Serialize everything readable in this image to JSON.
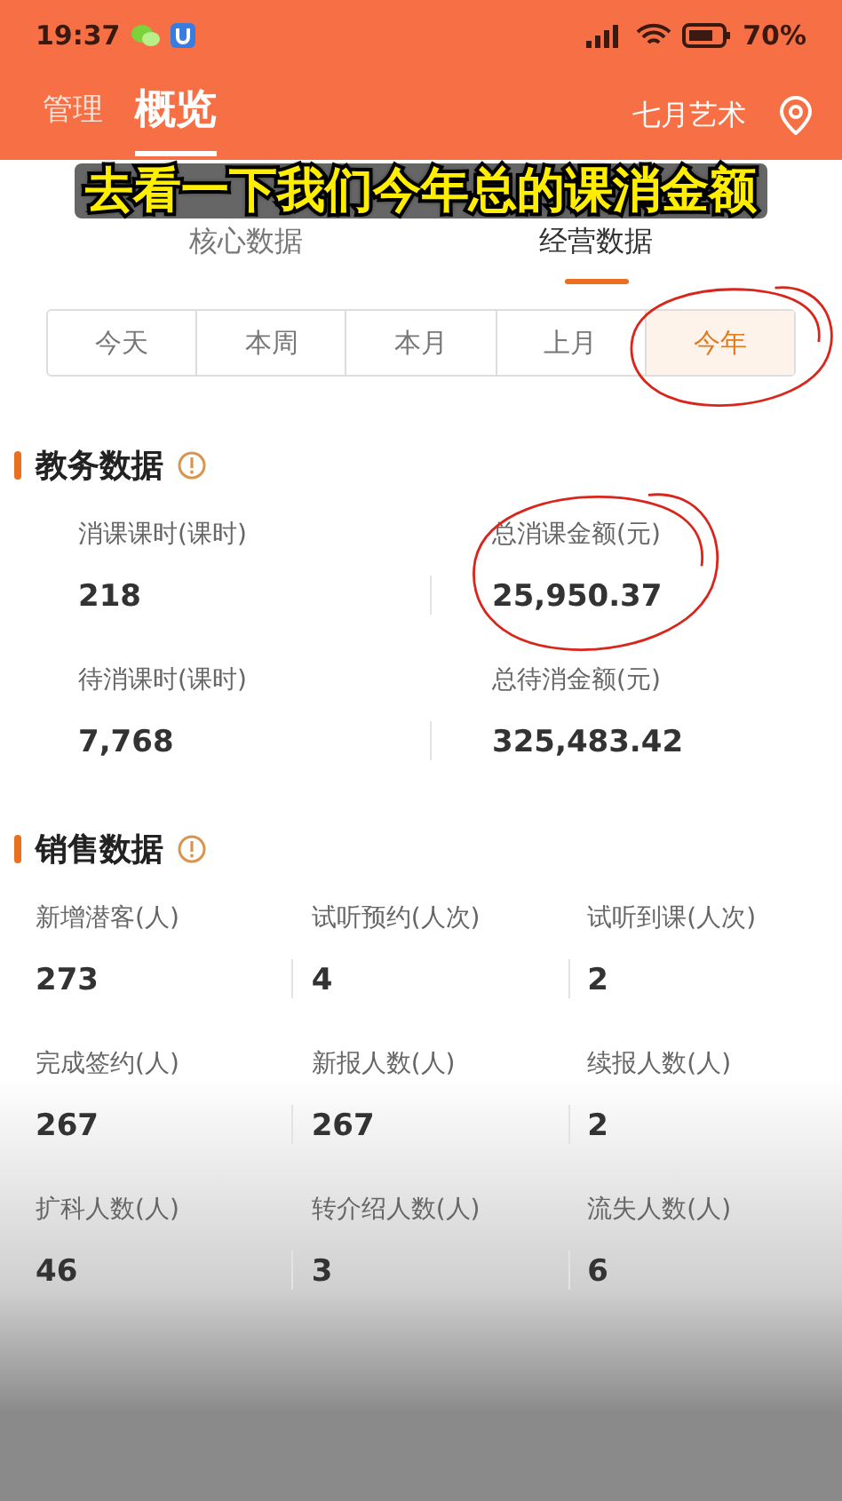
{
  "status_bar": {
    "time": "19:37",
    "battery": "70%"
  },
  "header": {
    "tabs": [
      {
        "label": "管理",
        "selected": false
      },
      {
        "label": "概览",
        "selected": true
      }
    ],
    "org": "七月艺术"
  },
  "caption": "去看一下我们今年总的课消金额",
  "sub_tabs": [
    {
      "label": "核心数据",
      "selected": false
    },
    {
      "label": "经营数据",
      "selected": true
    }
  ],
  "periods": [
    {
      "label": "今天",
      "selected": false,
      "circled": false
    },
    {
      "label": "本周",
      "selected": false,
      "circled": false
    },
    {
      "label": "本月",
      "selected": false,
      "circled": false
    },
    {
      "label": "上月",
      "selected": false,
      "circled": false
    },
    {
      "label": "今年",
      "selected": true,
      "circled": true
    }
  ],
  "sections": [
    {
      "title": "教务数据",
      "metrics": [
        {
          "label": "消课课时(课时)",
          "value": "218",
          "circled": false
        },
        {
          "label": "总消课金额(元)",
          "value": "25,950.37",
          "circled": true
        },
        {
          "label": "待消课时(课时)",
          "value": "7,768",
          "circled": false
        },
        {
          "label": "总待消金额(元)",
          "value": "325,483.42",
          "circled": false
        }
      ]
    },
    {
      "title": "销售数据",
      "metrics": [
        {
          "label": "新增潜客(人)",
          "value": "273",
          "circled": false
        },
        {
          "label": "试听预约(人次)",
          "value": "4",
          "circled": false
        },
        {
          "label": "试听到课(人次)",
          "value": "2",
          "circled": false
        },
        {
          "label": "完成签约(人)",
          "value": "267",
          "circled": false
        },
        {
          "label": "新报人数(人)",
          "value": "267",
          "circled": false
        },
        {
          "label": "续报人数(人)",
          "value": "2",
          "circled": false
        },
        {
          "label": "扩科人数(人)",
          "value": "46",
          "circled": false
        },
        {
          "label": "转介绍人数(人)",
          "value": "3",
          "circled": false
        },
        {
          "label": "流失人数(人)",
          "value": "6",
          "circled": false
        }
      ]
    }
  ]
}
